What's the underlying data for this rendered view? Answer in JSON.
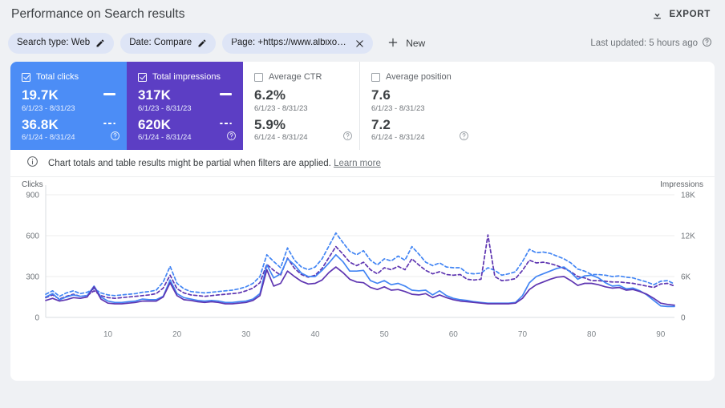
{
  "header": {
    "title": "Performance on Search results",
    "export_label": "EXPORT",
    "export_icon": "download-icon"
  },
  "filters": {
    "chips": [
      {
        "label": "Search type: Web",
        "trailing_icon": "pencil-icon"
      },
      {
        "label": "Date: Compare",
        "trailing_icon": "pencil-icon"
      },
      {
        "label": "Page: +https://www.albixon....",
        "trailing_icon": "close-icon"
      }
    ],
    "new_button": {
      "label": "New",
      "icon": "plus-icon"
    },
    "last_updated": "Last updated: 5 hours ago",
    "last_updated_icon": "help-icon"
  },
  "metrics": [
    {
      "name": "Total clicks",
      "checked": true,
      "style": "blue",
      "color": "#4c8df6",
      "primary_value": "19.7K",
      "primary_range": "6/1/23 - 8/31/23",
      "compare_value": "36.8K",
      "compare_range": "6/1/24 - 8/31/24"
    },
    {
      "name": "Total impressions",
      "checked": true,
      "style": "purple",
      "color": "#5c3ec4",
      "primary_value": "317K",
      "primary_range": "6/1/23 - 8/31/23",
      "compare_value": "620K",
      "compare_range": "6/1/24 - 8/31/24"
    },
    {
      "name": "Average CTR",
      "checked": false,
      "style": "plain",
      "color": "#ffffff",
      "primary_value": "6.2%",
      "primary_range": "6/1/23 - 8/31/23",
      "compare_value": "5.9%",
      "compare_range": "6/1/24 - 8/31/24"
    },
    {
      "name": "Average position",
      "checked": false,
      "style": "plain",
      "color": "#ffffff",
      "primary_value": "7.6",
      "primary_range": "6/1/23 - 8/31/23",
      "compare_value": "7.2",
      "compare_range": "6/1/24 - 8/31/24"
    }
  ],
  "banner": {
    "icon": "info-icon",
    "text": "Chart totals and table results might be partial when filters are applied.",
    "link": "Learn more"
  },
  "chart_data": {
    "type": "line",
    "title": "",
    "xlabel": "",
    "ylabel": "Clicks",
    "y2label": "Impressions",
    "grid": true,
    "legend_position": "metric-cards",
    "xlim": [
      1,
      92
    ],
    "xticks": [
      10,
      20,
      30,
      40,
      50,
      60,
      70,
      80,
      90
    ],
    "ylim": [
      0,
      900
    ],
    "yticks": [
      0,
      300,
      600,
      900
    ],
    "yticklabels": [
      "0",
      "300",
      "600",
      "900"
    ],
    "y2lim": [
      0,
      18000
    ],
    "y2ticks": [
      0,
      6000,
      12000,
      18000
    ],
    "y2ticklabels": [
      "0",
      "6K",
      "12K",
      "18K"
    ],
    "x": [
      1,
      2,
      3,
      4,
      5,
      6,
      7,
      8,
      9,
      10,
      11,
      12,
      13,
      14,
      15,
      16,
      17,
      18,
      19,
      20,
      21,
      22,
      23,
      24,
      25,
      26,
      27,
      28,
      29,
      30,
      31,
      32,
      33,
      34,
      35,
      36,
      37,
      38,
      39,
      40,
      41,
      42,
      43,
      44,
      45,
      46,
      47,
      48,
      49,
      50,
      51,
      52,
      53,
      54,
      55,
      56,
      57,
      58,
      59,
      60,
      61,
      62,
      63,
      64,
      65,
      66,
      67,
      68,
      69,
      70,
      71,
      72,
      73,
      74,
      75,
      76,
      77,
      78,
      79,
      80,
      81,
      82,
      83,
      84,
      85,
      86,
      87,
      88,
      89,
      90,
      91,
      92
    ],
    "series": [
      {
        "name": "Clicks 6/1/24 - 8/31/24",
        "axis": "left",
        "style": "solid",
        "color": "#4285f4",
        "values": [
          150,
          175,
          130,
          150,
          165,
          155,
          160,
          230,
          150,
          120,
          110,
          110,
          115,
          120,
          135,
          130,
          130,
          155,
          275,
          175,
          145,
          135,
          125,
          120,
          125,
          120,
          110,
          110,
          115,
          120,
          135,
          175,
          385,
          290,
          320,
          430,
          385,
          325,
          300,
          300,
          345,
          400,
          460,
          410,
          340,
          340,
          345,
          270,
          250,
          270,
          240,
          250,
          230,
          200,
          195,
          200,
          165,
          195,
          160,
          140,
          130,
          125,
          115,
          110,
          105,
          105,
          105,
          105,
          110,
          160,
          255,
          300,
          320,
          340,
          360,
          370,
          330,
          280,
          305,
          310,
          290,
          255,
          230,
          235,
          210,
          215,
          195,
          165,
          125,
          85,
          80,
          80
        ]
      },
      {
        "name": "Clicks 6/1/23 - 8/31/23",
        "axis": "left",
        "style": "solid",
        "color": "#5e35b1",
        "values": [
          125,
          140,
          120,
          130,
          145,
          140,
          150,
          225,
          135,
          105,
          100,
          100,
          105,
          110,
          120,
          120,
          120,
          150,
          255,
          160,
          130,
          125,
          115,
          110,
          115,
          110,
          100,
          100,
          105,
          110,
          125,
          160,
          350,
          230,
          250,
          340,
          300,
          265,
          245,
          250,
          275,
          330,
          370,
          330,
          280,
          260,
          255,
          220,
          205,
          225,
          200,
          205,
          190,
          170,
          165,
          175,
          145,
          165,
          145,
          130,
          120,
          115,
          110,
          105,
          100,
          100,
          100,
          100,
          105,
          140,
          205,
          240,
          260,
          280,
          295,
          300,
          270,
          235,
          250,
          250,
          240,
          225,
          215,
          220,
          200,
          205,
          190,
          170,
          140,
          105,
          95,
          90
        ]
      },
      {
        "name": "Impressions 6/1/24 - 8/31/24",
        "axis": "right",
        "style": "dashed",
        "color": "#4285f4",
        "values": [
          3400,
          3900,
          3100,
          3600,
          3900,
          3500,
          3700,
          4200,
          3600,
          3300,
          3200,
          3300,
          3400,
          3500,
          3700,
          3800,
          4000,
          5200,
          7500,
          5000,
          4200,
          3800,
          3700,
          3600,
          3700,
          3800,
          3900,
          4000,
          4200,
          4500,
          5000,
          6000,
          9200,
          8200,
          7300,
          10200,
          8400,
          7400,
          7000,
          7400,
          8600,
          10500,
          12400,
          11000,
          9700,
          9200,
          9800,
          8400,
          7700,
          8600,
          8300,
          9000,
          8400,
          10400,
          9300,
          8100,
          7600,
          8000,
          7400,
          7300,
          7300,
          6500,
          6400,
          6500,
          7300,
          6900,
          6200,
          6400,
          6700,
          8200,
          10000,
          9500,
          9600,
          9400,
          9000,
          8600,
          8000,
          7100,
          6800,
          6300,
          6300,
          6200,
          6000,
          6100,
          5900,
          5800,
          5500,
          5200,
          4800,
          5300,
          5400,
          4900
        ]
      },
      {
        "name": "Impressions 6/1/23 - 8/31/23",
        "axis": "right",
        "style": "dashed",
        "color": "#5e35b1",
        "values": [
          2900,
          3300,
          2700,
          3100,
          3400,
          3100,
          3200,
          3900,
          3200,
          2900,
          2800,
          2900,
          3000,
          3100,
          3200,
          3300,
          3500,
          4300,
          6200,
          4200,
          3600,
          3300,
          3200,
          3100,
          3200,
          3300,
          3400,
          3500,
          3600,
          3900,
          4300,
          5100,
          7800,
          6900,
          6200,
          8700,
          7200,
          6300,
          5900,
          6200,
          7200,
          8800,
          10400,
          9300,
          8100,
          7600,
          8100,
          7000,
          6400,
          7300,
          7000,
          7500,
          7000,
          8600,
          7700,
          6900,
          6400,
          6700,
          6300,
          6200,
          6300,
          5600,
          5500,
          5600,
          12100,
          6000,
          5400,
          5500,
          5700,
          6900,
          8400,
          8000,
          8100,
          7900,
          7600,
          7200,
          6700,
          6000,
          5800,
          5400,
          5400,
          5300,
          5200,
          5200,
          5100,
          5000,
          4800,
          4600,
          4400,
          4900,
          5000,
          4600
        ]
      }
    ]
  }
}
